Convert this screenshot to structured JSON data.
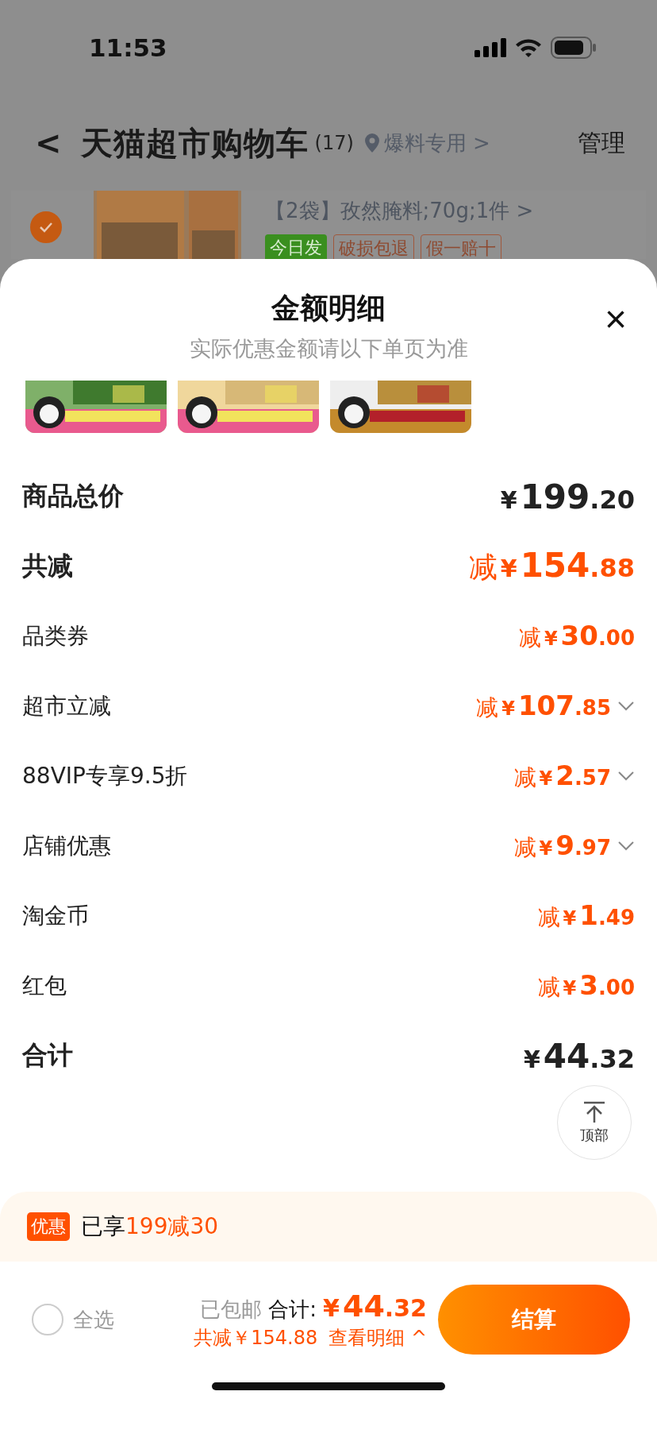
{
  "status_bar": {
    "time": "11:53"
  },
  "header": {
    "back": "<",
    "title": "天猫超市购物车",
    "count": "(17)",
    "address": "爆料专用",
    "address_arrow": ">",
    "manage": "管理"
  },
  "cart_item": {
    "checked": true,
    "name": "【2袋】孜然腌料;70g;1件",
    "arrow": ">",
    "tags": [
      {
        "kind": "fast",
        "text": "今日发"
      },
      {
        "kind": "outline",
        "text": "破损包退"
      },
      {
        "kind": "outline",
        "text": "假一赔十"
      }
    ]
  },
  "sheet": {
    "title": "金额明细",
    "subtitle": "实际优惠金额请以下单页为准",
    "close": "×",
    "rows": [
      {
        "kind": "total",
        "label": "商品总价",
        "prefix": "",
        "currency": "¥",
        "whole": "199",
        "fraction": ".20",
        "expandable": false
      },
      {
        "kind": "discount-total",
        "label": "共减",
        "prefix": "减",
        "currency": "¥",
        "whole": "154",
        "fraction": ".88",
        "expandable": false
      },
      {
        "kind": "item",
        "label": "品类券",
        "prefix": "减",
        "currency": "¥",
        "whole": "30",
        "fraction": ".00",
        "expandable": false
      },
      {
        "kind": "item",
        "label": "超市立减",
        "prefix": "减",
        "currency": "¥",
        "whole": "107",
        "fraction": ".85",
        "expandable": true
      },
      {
        "kind": "item",
        "label": "88VIP专享9.5折",
        "prefix": "减",
        "currency": "¥",
        "whole": "2",
        "fraction": ".57",
        "expandable": true
      },
      {
        "kind": "item",
        "label": "店铺优惠",
        "prefix": "减",
        "currency": "¥",
        "whole": "9",
        "fraction": ".97",
        "expandable": true
      },
      {
        "kind": "item",
        "label": "淘金币",
        "prefix": "减",
        "currency": "¥",
        "whole": "1",
        "fraction": ".49",
        "expandable": false
      },
      {
        "kind": "item",
        "label": "红包",
        "prefix": "减",
        "currency": "¥",
        "whole": "3",
        "fraction": ".00",
        "expandable": false
      },
      {
        "kind": "total",
        "label": "合计",
        "prefix": "",
        "currency": "¥",
        "whole": "44",
        "fraction": ".32",
        "expandable": false
      }
    ],
    "top_button": "顶部"
  },
  "promo": {
    "badge": "优惠",
    "text": "已享",
    "highlight": "199减30"
  },
  "footer": {
    "select_all": {
      "label": "全选",
      "checked": false
    },
    "shipping": "已包邮",
    "total_label": "合计:",
    "currency": "¥",
    "whole": "44",
    "fraction": ".32",
    "saved": "共减￥154.88",
    "details": "查看明细",
    "details_arrow": "^",
    "checkout": "结算"
  }
}
